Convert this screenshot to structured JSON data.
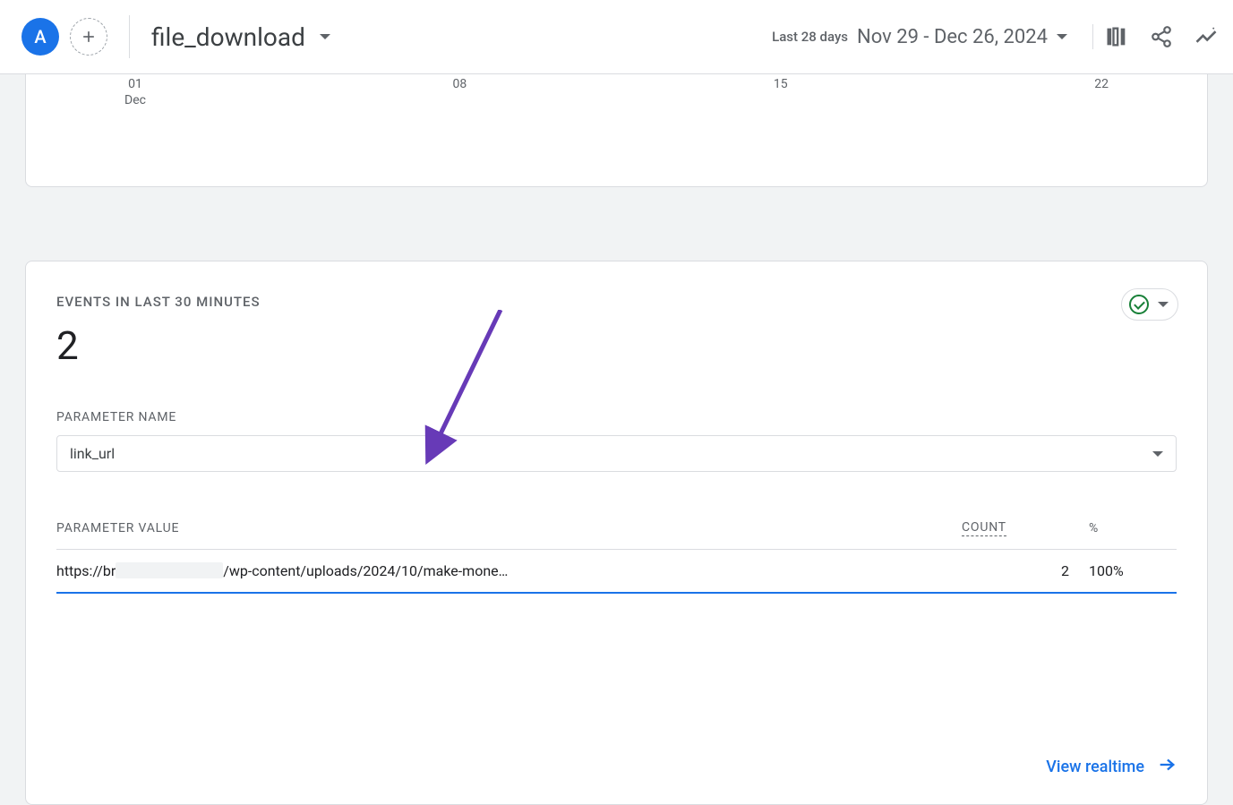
{
  "header": {
    "avatar_letter": "A",
    "report_name": "file_download",
    "date_period_label": "Last 28 days",
    "date_range": "Nov 29 - Dec 26, 2024"
  },
  "chart": {
    "ticks": [
      {
        "day": "01",
        "month": "Dec"
      },
      {
        "day": "08",
        "month": ""
      },
      {
        "day": "15",
        "month": ""
      },
      {
        "day": "22",
        "month": ""
      }
    ]
  },
  "events_card": {
    "title": "EVENTS IN LAST 30 MINUTES",
    "count": "2",
    "parameter_name_label": "PARAMETER NAME",
    "parameter_name_value": "link_url",
    "table": {
      "col_value": "PARAMETER VALUE",
      "col_count": "COUNT",
      "col_percent": "%",
      "rows": [
        {
          "value_prefix": "https://br",
          "value_suffix": "/wp-content/uploads/2024/10/make-mone…",
          "count": "2",
          "percent": "100%"
        }
      ]
    },
    "view_realtime": "View realtime"
  }
}
